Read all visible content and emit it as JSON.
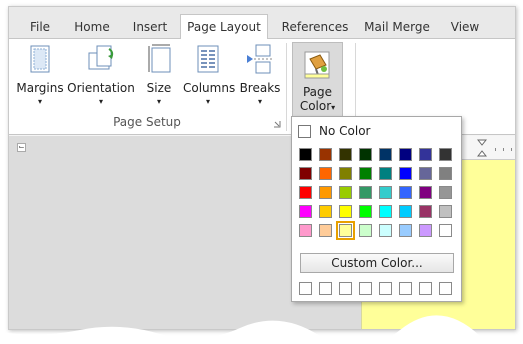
{
  "tabs": [
    "File",
    "Home",
    "Insert",
    "Page Layout",
    "References",
    "Mail Merge",
    "View"
  ],
  "active_tab": "Page Layout",
  "ribbon": {
    "margins_label": "Margins",
    "orientation_label": "Orientation",
    "size_label": "Size",
    "columns_label": "Columns",
    "breaks_label": "Breaks",
    "group_label": "Page Setup",
    "page_color_line1": "Page",
    "page_color_line2": "Color",
    "dropdown_arrow": "▾"
  },
  "popup": {
    "no_color_label": "No Color",
    "custom_color_label": "Custom Color...",
    "selected_color": "#ffff99",
    "palette": [
      [
        "#000000",
        "#993300",
        "#333300",
        "#003300",
        "#003366",
        "#000080",
        "#333399",
        "#333333"
      ],
      [
        "#800000",
        "#ff6600",
        "#808000",
        "#008000",
        "#008080",
        "#0000ff",
        "#666699",
        "#808080"
      ],
      [
        "#ff0000",
        "#ff9900",
        "#99cc00",
        "#339966",
        "#33cccc",
        "#3366ff",
        "#800080",
        "#969696"
      ],
      [
        "#ff00ff",
        "#ffcc00",
        "#ffff00",
        "#00ff00",
        "#00ffff",
        "#00ccff",
        "#993366",
        "#c0c0c0"
      ],
      [
        "#ff99cc",
        "#ffcc99",
        "#ffff99",
        "#ccffcc",
        "#ccffff",
        "#99ccff",
        "#cc99ff",
        "#ffffff"
      ]
    ],
    "recent_colors": [
      "#ffffff",
      "#ffffff",
      "#ffffff",
      "#ffffff",
      "#ffffff",
      "#ffffff",
      "#ffffff",
      "#ffffff"
    ]
  },
  "document": {
    "page_color": "#ffff99"
  }
}
